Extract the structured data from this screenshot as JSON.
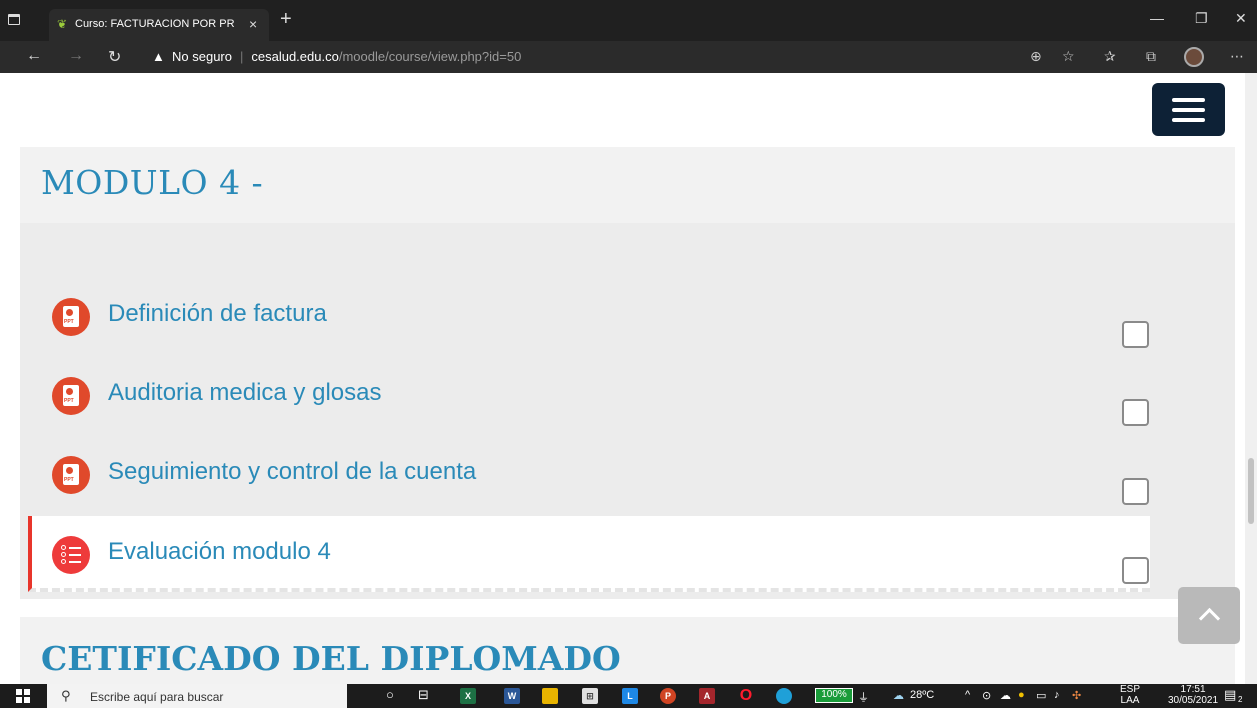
{
  "browser": {
    "tab_title": "Curso: FACTURACION POR PRES",
    "security_label": "No seguro",
    "url_host": "cesalud.edu.co",
    "url_path": "/moodle/course/view.php?id=50",
    "new_tab": "+",
    "tab_close": "×"
  },
  "section": {
    "title": "MODULO 4 -",
    "activities": [
      {
        "label": "Definición de factura",
        "icon": "ppt-file-icon",
        "completed": false
      },
      {
        "label": "Auditoria medica y glosas",
        "icon": "ppt-file-icon",
        "completed": false
      },
      {
        "label": "Seguimiento y control de la cuenta",
        "icon": "ppt-file-icon",
        "completed": false
      },
      {
        "label": "Evaluación modulo 4",
        "icon": "quiz-list-icon",
        "completed": false
      }
    ]
  },
  "next_section": {
    "title": "CETIFICADO DEL DIPLOMADO"
  },
  "taskbar": {
    "search_placeholder": "Escribe aquí para buscar",
    "battery": "100%",
    "temperature": "28ºC",
    "lang_top": "ESP",
    "lang_bottom": "LAA",
    "time": "17:51",
    "date": "30/05/2021",
    "notifications": "2"
  },
  "colors": {
    "accent": "#2a8ab8",
    "navbar": "#0d2136",
    "ppt": "#e0492b",
    "highlight_border": "#e8352b"
  }
}
